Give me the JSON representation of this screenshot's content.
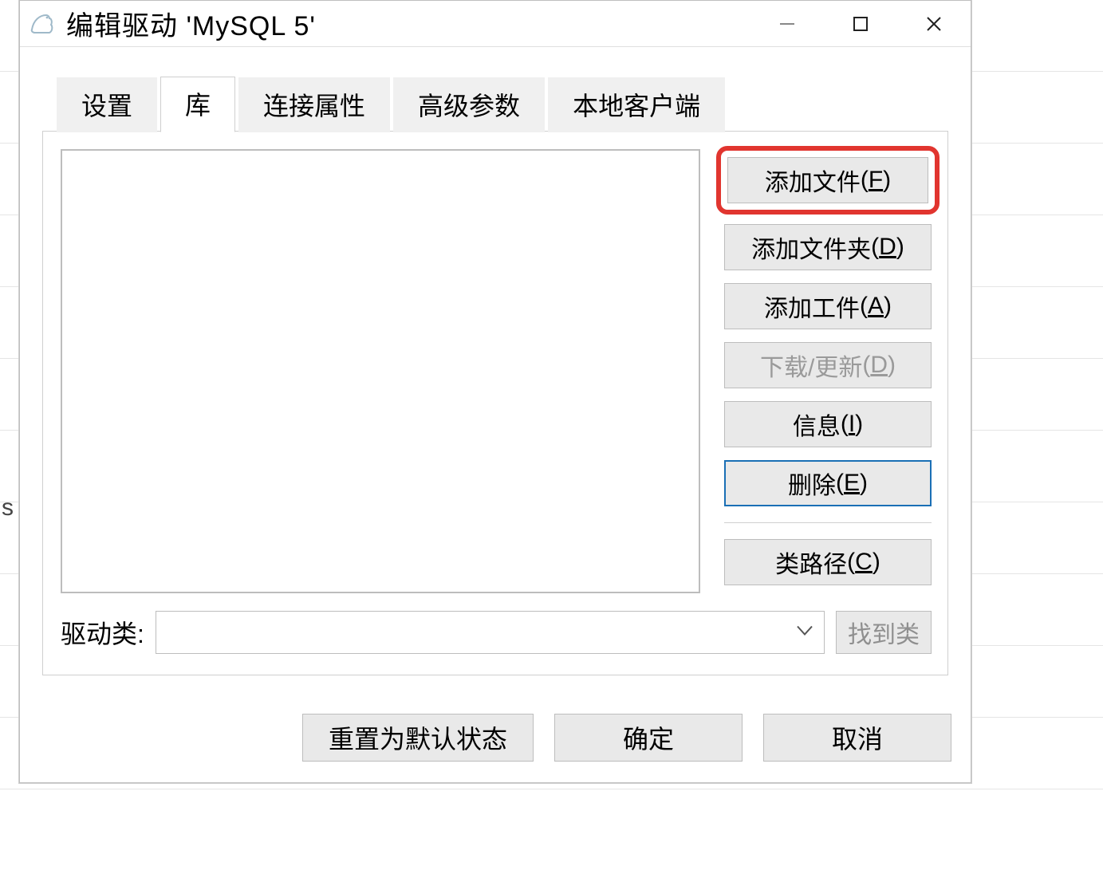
{
  "window": {
    "title": "编辑驱动 'MySQL 5'"
  },
  "tabs": {
    "settings": "设置",
    "library": "库",
    "connection_props": "连接属性",
    "advanced_params": "高级参数",
    "local_client": "本地客户端"
  },
  "side": {
    "add_file": "添加文件",
    "add_file_mn": "F",
    "add_folder": "添加文件夹",
    "add_folder_mn": "D",
    "add_artifact": "添加工件",
    "add_artifact_mn": "A",
    "download_update": "下载/更新",
    "download_update_mn": "D",
    "info": "信息",
    "info_mn": "I",
    "delete": "删除",
    "delete_mn": "E",
    "classpath": "类路径",
    "classpath_mn": "C"
  },
  "driver_class": {
    "label": "驱动类:",
    "value": "",
    "find_button": "找到类"
  },
  "footer": {
    "reset": "重置为默认状态",
    "ok": "确定",
    "cancel": "取消"
  },
  "bg": {
    "s": "s"
  }
}
